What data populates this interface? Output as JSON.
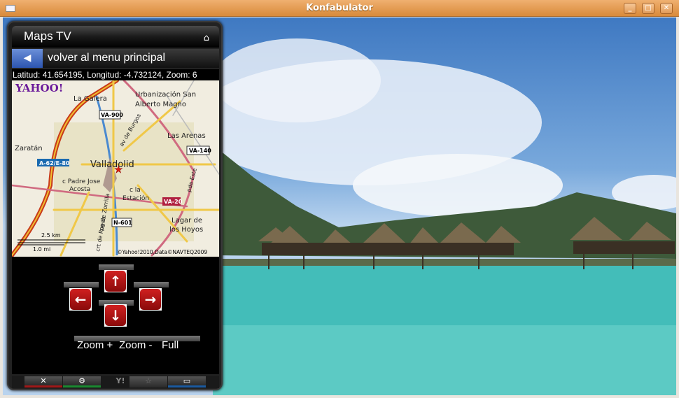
{
  "window": {
    "title": "Konfabulator",
    "buttons": [
      "_",
      "□",
      "✕"
    ]
  },
  "widget": {
    "title": "Maps TV",
    "home_icon": "home-icon",
    "back_label": "volver al menu principal",
    "status": "Latitud: 41.654195, Longitud: -4.732124, Zoom: 6",
    "map": {
      "logo": "YAHOO!",
      "labels": [
        "La Galera",
        "Urbanización San",
        "Alberto Magno",
        "Las Arenas",
        "Zaratán",
        "Valladolid",
        "c Padre Jose",
        "Acosta",
        "c la",
        "Estación",
        "Lagar de",
        "los Hoyos",
        "av de Burgos",
        "pda Este",
        "pg de Zorrilla",
        "crt de Rueda"
      ],
      "shields": [
        "VA-900",
        "VA-140",
        "A-62/E-80",
        "VA-20",
        "N-601"
      ],
      "scale_km": "2.5 km",
      "scale_mi": "1.0 mi",
      "copyright": "©Yahoo!2010,Data©NAVTEQ2009"
    },
    "zoom_buttons": [
      "Zoom +",
      "Zoom -",
      "Full"
    ],
    "bottom": [
      {
        "icon": "close-icon",
        "glyph": "✕",
        "color": "#a01818"
      },
      {
        "icon": "gear-icon",
        "glyph": "⚙",
        "color": "#1a8a30"
      },
      {
        "icon": "yahoo-icon",
        "glyph": "Y!"
      },
      {
        "icon": "star-icon",
        "glyph": "☆"
      },
      {
        "icon": "window-icon",
        "glyph": "▭",
        "color": "#1a5aa0"
      }
    ]
  }
}
